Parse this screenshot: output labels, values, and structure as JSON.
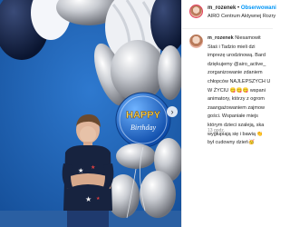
{
  "post": {
    "username": "m_rozenek",
    "header_separator": "•",
    "follow_label": "Obserwowani",
    "location": "AIRO Centrum Aktywnej Rozry",
    "caption_username": "m_rozenek",
    "caption_lines": [
      "Staś i Tadzio mieli dzi",
      "imprezę urodzinową. Bard",
      "dziękujemy @airo_active_",
      "zorganizowanie zdaniem",
      "chłopców NAJLEPSZYCH U",
      "W ŻYCIU 😋😋😋 wspani",
      "animatory, którzy z ogrom",
      "zaangażowaniem zajmow",
      "gości. Wspaniałe miejs",
      "którym dzieci szaleją, ska",
      "wygłupiają się i bawią 👏",
      "był cudowny dzień🥳"
    ],
    "caption_first_tail": "Niesamowit",
    "timestamp": "13 godz."
  },
  "photo": {
    "balloon_text_top": "HAPPY",
    "balloon_text_bottom": "Birthday",
    "next_icon": "chevron-right-icon"
  },
  "colors": {
    "wall": "#1f63b4",
    "follow_blue": "#0095f6",
    "balloon_navy": "#10203f",
    "balloon_blue": "#1763c9"
  }
}
